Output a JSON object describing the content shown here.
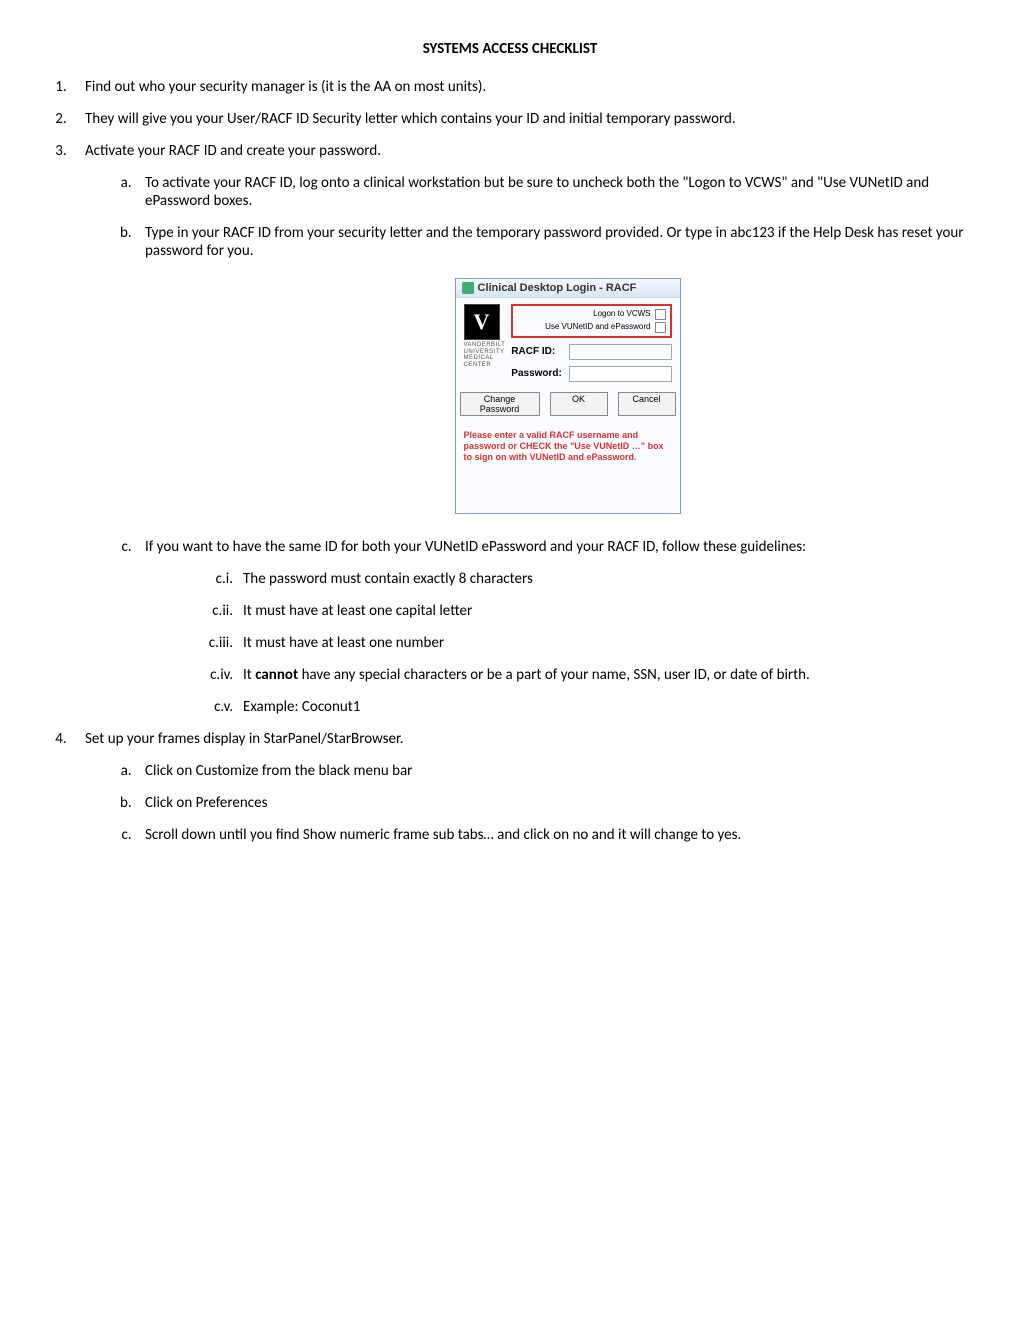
{
  "title": "SYSTEMS ACCESS CHECKLIST",
  "list": {
    "i1": "Find out who your security manager is (it is the AA on most units).",
    "i2": "They will give you your User/RACF ID Security letter which contains your ID and initial temporary password.",
    "i3": "Activate your RACF ID and create your password.",
    "i3a": "To activate your RACF ID, log onto a clinical workstation but be sure to uncheck both the \"Logon to VCWS\" and \"Use VUNetID and ePassword boxes.",
    "i3b": "Type in your RACF ID from your security letter and the temporary password provided.  Or type in abc123 if the Help Desk has reset your password for you.",
    "i3c": "If you want to have the same ID for both your VUNetID ePassword and your RACF ID, follow these guidelines:",
    "i3c1_label": "c.i.",
    "i3c1": "The password must contain exactly 8 characters",
    "i3c2_label": "c.ii.",
    "i3c2": "It must have at least one capital letter",
    "i3c3_label": "c.iii.",
    "i3c3": "It must have at least one number",
    "i3c4_label": "c.iv.",
    "i3c4_pre": "It ",
    "i3c4_bold": "cannot",
    "i3c4_post": " have any special characters or be a part of your name, SSN, user ID, or date of birth.",
    "i3c5_label": "c.v.",
    "i3c5": "Example:  Coconut1",
    "i4": "Set up your frames display in StarPanel/StarBrowser.",
    "i4a": "Click on Customize from the black menu bar",
    "i4b": "Click on Preferences",
    "i4c": " Scroll down until you find Show numeric frame sub tabs… and click on no and it will change to yes."
  },
  "dialog": {
    "title": "Clinical Desktop Login - RACF",
    "logo": "V",
    "logo_caption1": "VANDERBILT",
    "logo_caption2": "UNIVERSITY",
    "logo_caption3": "MEDICAL",
    "logo_caption4": "CENTER",
    "chk1": "Logon to VCWS",
    "chk2": "Use VUNetID and ePassword",
    "racf_label": "RACF ID:",
    "pwd_label": "Password:",
    "btn_change": "Change Password",
    "btn_ok": "OK",
    "btn_cancel": "Cancel",
    "warn": "Please enter a valid RACF username and password or CHECK the \"Use VUNetID …\" box to sign on with VUNetID and ePassword."
  }
}
